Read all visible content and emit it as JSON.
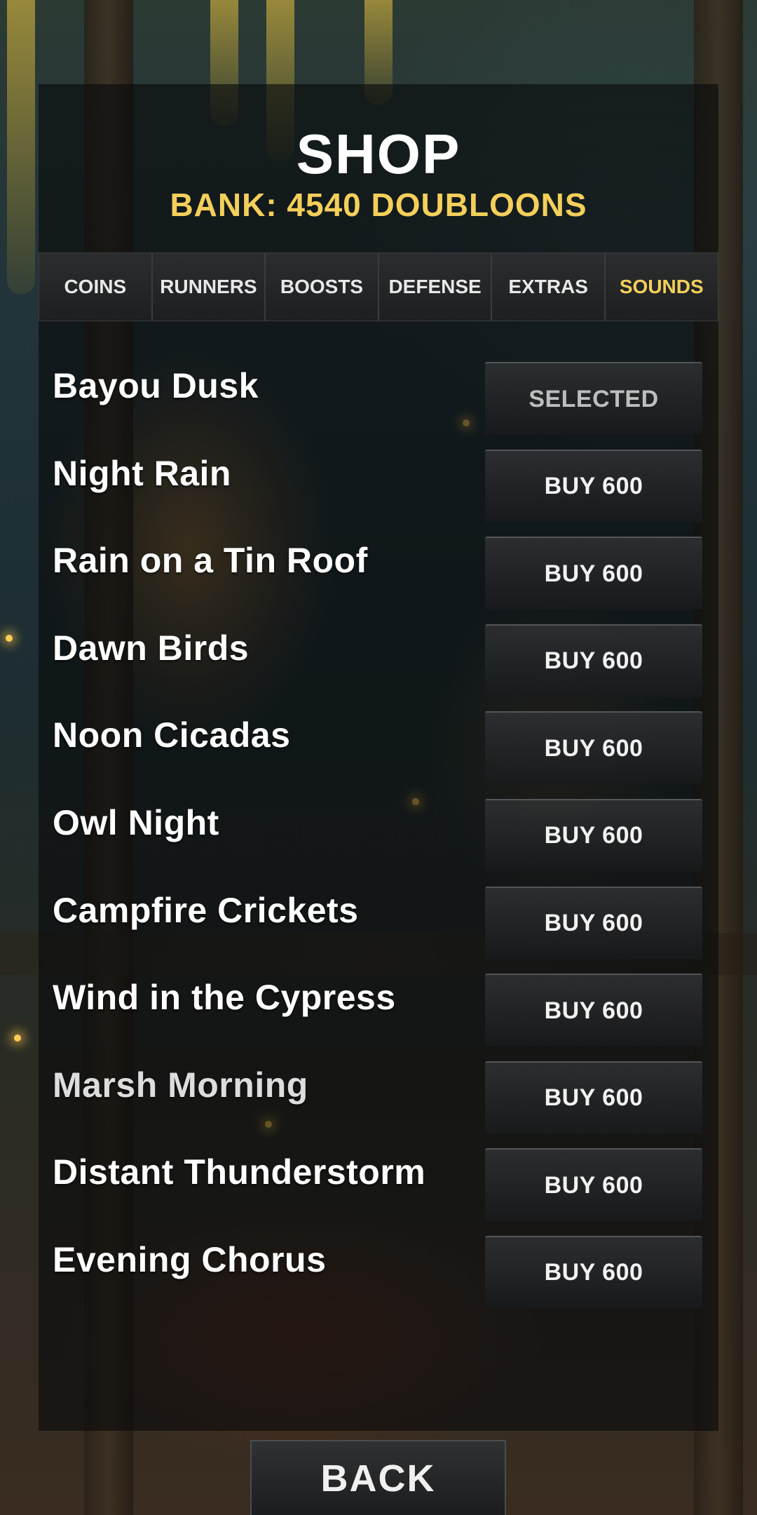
{
  "header": {
    "title": "SHOP",
    "bank": "BANK: 4540 DOUBLOONS"
  },
  "tabs": [
    {
      "label": "COINS",
      "active": false
    },
    {
      "label": "RUNNERS",
      "active": false
    },
    {
      "label": "BOOSTS",
      "active": false
    },
    {
      "label": "DEFENSE",
      "active": false
    },
    {
      "label": "EXTRAS",
      "active": false
    },
    {
      "label": "SOUNDS",
      "active": true
    }
  ],
  "items": [
    {
      "name": "Bayou Dusk",
      "action": "SELECTED"
    },
    {
      "name": "Night Rain",
      "action": "BUY 600"
    },
    {
      "name": "Rain on a Tin Roof",
      "action": "BUY 600"
    },
    {
      "name": "Dawn Birds",
      "action": "BUY 600"
    },
    {
      "name": "Noon Cicadas",
      "action": "BUY 600"
    },
    {
      "name": "Owl Night",
      "action": "BUY 600"
    },
    {
      "name": "Campfire Crickets",
      "action": "BUY 600"
    },
    {
      "name": "Wind in the Cypress",
      "action": "BUY 600"
    },
    {
      "name": "Marsh Morning",
      "action": "BUY 600"
    },
    {
      "name": "Distant Thunderstorm",
      "action": "BUY 600"
    },
    {
      "name": "Evening Chorus",
      "action": "BUY 600"
    }
  ],
  "footer": {
    "back_label": "BACK"
  },
  "colors": {
    "accent": "#f4cf5a",
    "text": "#ffffff"
  }
}
